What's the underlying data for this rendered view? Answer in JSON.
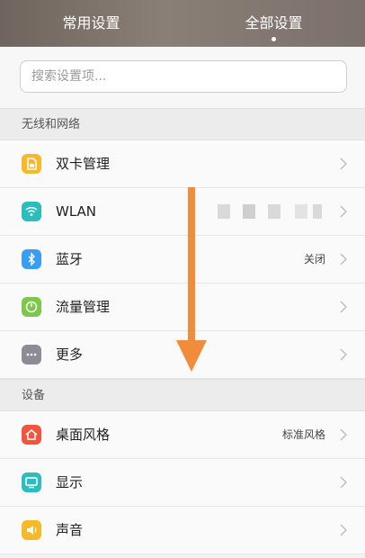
{
  "tabs": [
    {
      "label": "常用设置",
      "active": false
    },
    {
      "label": "全部设置",
      "active": true
    }
  ],
  "search": {
    "placeholder": "搜索设置项..."
  },
  "sections": [
    {
      "title": "无线和网络"
    },
    {
      "title": "设备"
    }
  ],
  "items": [
    {
      "label": "双卡管理",
      "value": "",
      "icon": "sim-card-icon",
      "color": "#f7b928"
    },
    {
      "label": "WLAN",
      "value": "",
      "icon": "wifi-icon",
      "color": "#2ebdbd"
    },
    {
      "label": "蓝牙",
      "value": "关闭",
      "icon": "bluetooth-icon",
      "color": "#3a9df2"
    },
    {
      "label": "流量管理",
      "value": "",
      "icon": "data-usage-icon",
      "color": "#7cc84a"
    },
    {
      "label": "更多",
      "value": "",
      "icon": "more-icon",
      "color": "#8c8c96"
    },
    {
      "label": "桌面风格",
      "value": "标准风格",
      "icon": "home-icon",
      "color": "#f2553f"
    },
    {
      "label": "显示",
      "value": "",
      "icon": "display-icon",
      "color": "#2ebdbd"
    },
    {
      "label": "声音",
      "value": "",
      "icon": "sound-icon",
      "color": "#f7b928"
    }
  ],
  "annotation": {
    "icon": "down-arrow-icon",
    "color": "#f28c3a"
  }
}
